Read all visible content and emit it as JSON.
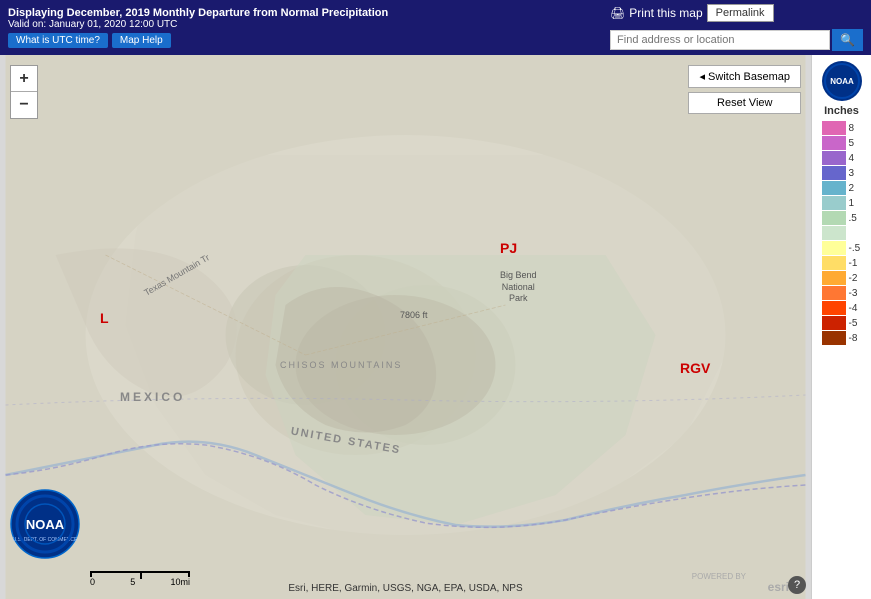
{
  "header": {
    "title": "Displaying December, 2019 Monthly Departure from Normal Precipitation",
    "valid": "Valid on: January 01, 2020 12:00 UTC",
    "utc_btn": "What is UTC time?",
    "help_btn": "Map Help",
    "print_label": "Print this map",
    "permalink_label": "Permalink"
  },
  "search": {
    "placeholder": "Find address or location"
  },
  "map_controls": {
    "zoom_in": "+",
    "zoom_out": "−",
    "switch_basemap": "◂ Switch Basemap",
    "reset_view": "Reset View"
  },
  "map_labels": {
    "pj": "PJ",
    "l": "L",
    "rgv": "RGV",
    "big_bend": "Big Bend\nNational\nPark",
    "elevation": "7806 ft",
    "chisos": "CHISOS MOUNTAINS",
    "texas_mountain": "Texas Mountain Tr",
    "mexico": "MEXICO",
    "united_states": "UNITED STATES"
  },
  "scale": {
    "labels": [
      "0",
      "5",
      "10mi"
    ]
  },
  "attribution": "Esri, HERE, Garmin, USGS, NGA, EPA, USDA, NPS",
  "legend": {
    "title": "Inches",
    "items": [
      {
        "label": "8",
        "color": "#e066b3"
      },
      {
        "label": "5",
        "color": "#c966c9"
      },
      {
        "label": "4",
        "color": "#9966cc"
      },
      {
        "label": "3",
        "color": "#6666cc"
      },
      {
        "label": "2",
        "color": "#66b3cc"
      },
      {
        "label": "1",
        "color": "#99cccc"
      },
      {
        "label": ".5",
        "color": "#b3d9b3"
      },
      {
        "label": "",
        "color": "#cce5cc"
      },
      {
        "label": "-.5",
        "color": "#ffff99"
      },
      {
        "label": "-1",
        "color": "#ffdd66"
      },
      {
        "label": "-2",
        "color": "#ffaa33"
      },
      {
        "label": "-3",
        "color": "#ff7733"
      },
      {
        "label": "-4",
        "color": "#ff4400"
      },
      {
        "label": "-5",
        "color": "#cc2200"
      },
      {
        "label": "-8",
        "color": "#993300"
      }
    ]
  }
}
